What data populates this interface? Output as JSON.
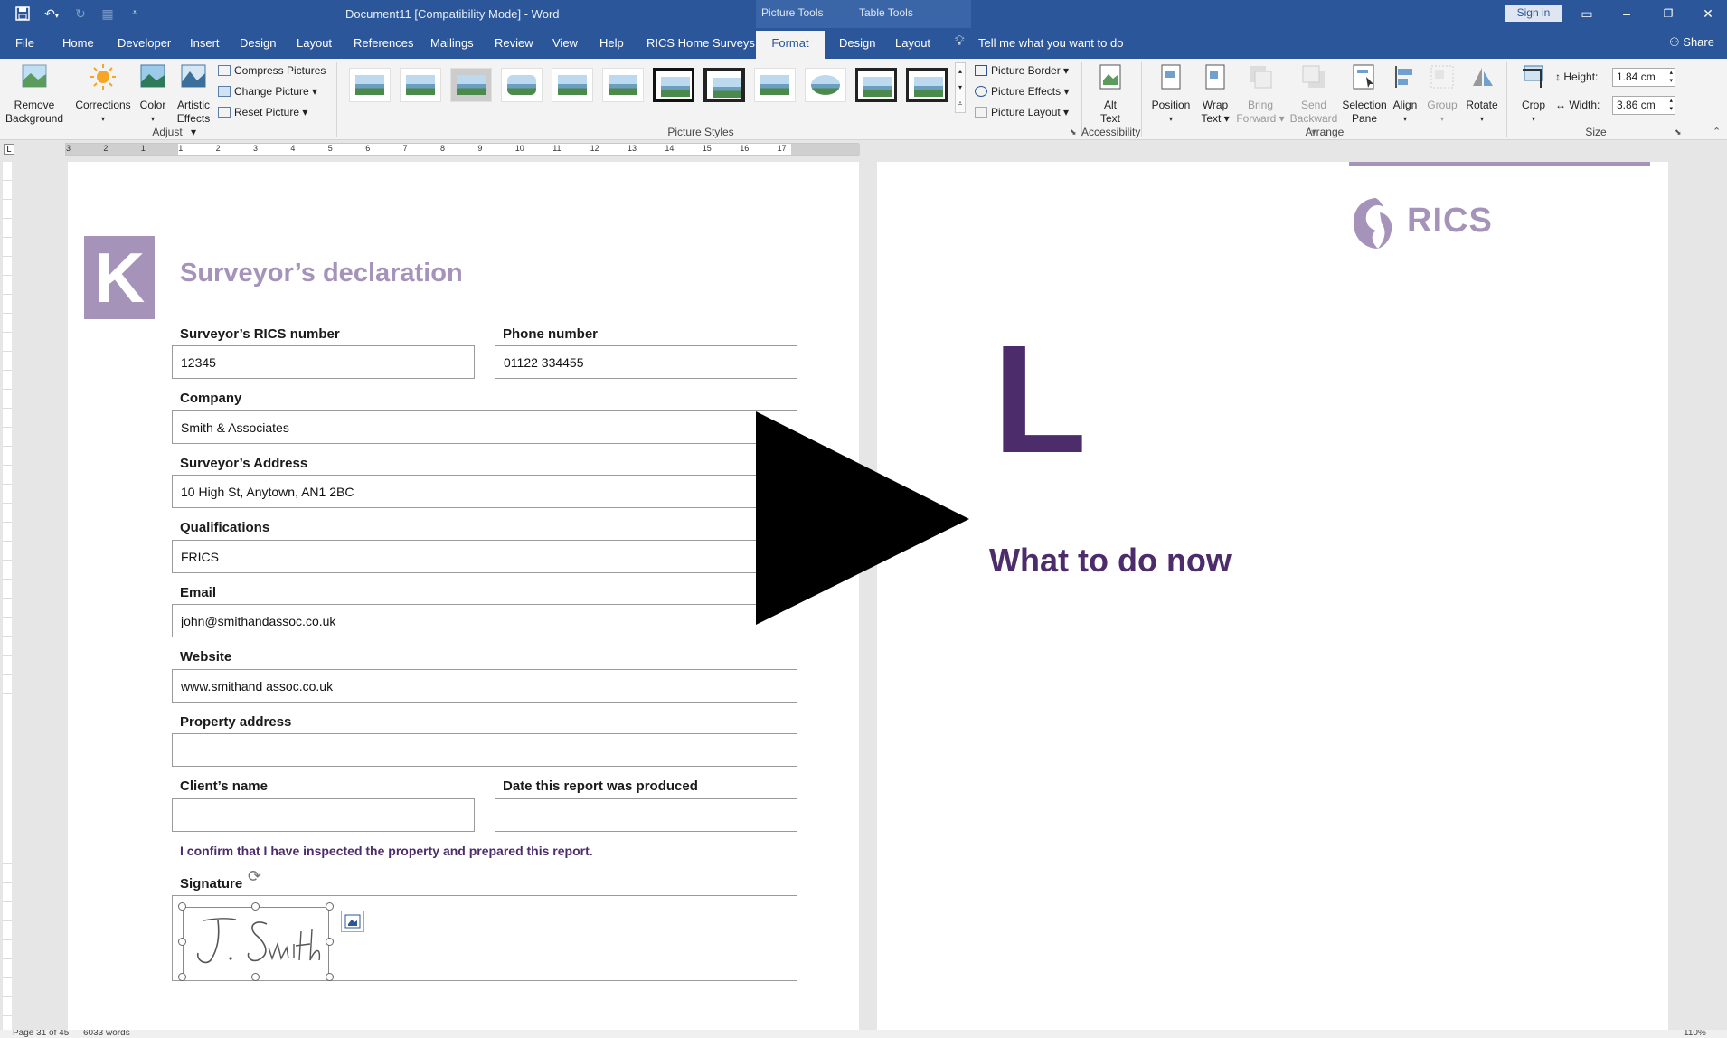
{
  "titlebar": {
    "document_title": "Document11 [Compatibility Mode] - Word",
    "picture_tools": "Picture Tools",
    "table_tools": "Table Tools",
    "sign_in": "Sign in"
  },
  "tabs": [
    "File",
    "Home",
    "Developer",
    "Insert",
    "Design",
    "Layout",
    "References",
    "Mailings",
    "Review",
    "View",
    "Help",
    "RICS Home Surveys",
    "Format",
    "Design",
    "Layout"
  ],
  "tell_me": "Tell me what you want to do",
  "share": "Share",
  "ribbon": {
    "remove_background": [
      "Remove",
      "Background"
    ],
    "corrections": "Corrections",
    "color": "Color",
    "artistic_effects": [
      "Artistic",
      "Effects"
    ],
    "compress_pictures": "Compress Pictures",
    "change_picture": "Change Picture",
    "reset_picture": "Reset Picture",
    "adjust_label": "Adjust",
    "picture_styles_label": "Picture Styles",
    "picture_border": "Picture Border",
    "picture_effects": "Picture Effects",
    "picture_layout": "Picture Layout",
    "alt_text": [
      "Alt",
      "Text"
    ],
    "accessibility_label": "Accessibility",
    "position": "Position",
    "wrap_text": [
      "Wrap",
      "Text"
    ],
    "bring_forward": [
      "Bring",
      "Forward"
    ],
    "send_backward": [
      "Send",
      "Backward"
    ],
    "selection_pane": [
      "Selection",
      "Pane"
    ],
    "align": "Align",
    "group": "Group",
    "rotate": "Rotate",
    "arrange_label": "Arrange",
    "crop": "Crop",
    "height_label": "Height:",
    "height_value": "1.84 cm",
    "width_label": "Width:",
    "width_value": "3.86 cm",
    "size_label": "Size"
  },
  "ruler_numbers": [
    "3",
    "2",
    "1",
    "1",
    "2",
    "3",
    "4",
    "5",
    "6",
    "7",
    "8",
    "9",
    "10",
    "11",
    "12",
    "13",
    "14",
    "15",
    "16",
    "17"
  ],
  "form": {
    "section_letter": "K",
    "title": "Surveyor’s declaration",
    "rics_number_label": "Surveyor’s RICS number",
    "rics_number_value": "12345",
    "phone_label": "Phone number",
    "phone_value": "01122 334455",
    "company_label": "Company",
    "company_value": "Smith & Associates",
    "address_label": "Surveyor’s Address",
    "address_value": "10 High St, Anytown, AN1 2BC",
    "qualifications_label": "Qualifications",
    "qualifications_value": "FRICS",
    "email_label": "Email",
    "email_value": "john@smithandassoc.co.uk",
    "website_label": "Website",
    "website_value": "www.smithand assoc.co.uk",
    "property_label": "Property address",
    "property_value": "",
    "client_label": "Client’s name",
    "client_value": "",
    "date_label": "Date this report was produced",
    "date_value": "",
    "confirm": "I confirm that I have inspected the property and prepared this report.",
    "signature_label": "Signature",
    "signature_text": "J. Smith"
  },
  "right_page": {
    "logo_text": "RICS",
    "section_letter": "L",
    "heading": "What to do now"
  },
  "status": {
    "page": "Page 31 of 45",
    "words": "6033 words",
    "zoom": "110%"
  },
  "colors": {
    "word_blue": "#2b579a",
    "lilac": "#a593ba",
    "purple": "#4d2c6b"
  }
}
